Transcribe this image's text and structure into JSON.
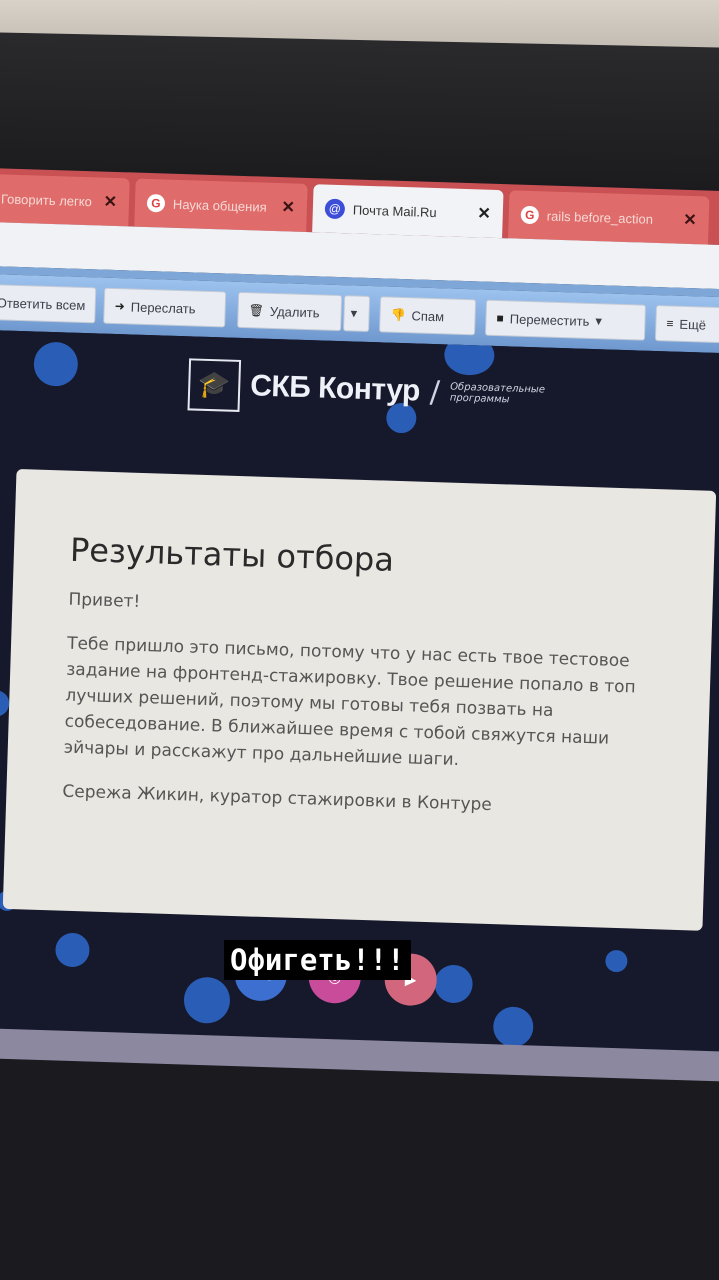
{
  "tabs": [
    {
      "title": "Говорить легко",
      "icon": "none",
      "close": "✕"
    },
    {
      "title": "Наука общения",
      "icon": "G",
      "close": "✕"
    },
    {
      "title": "Почта Mail.Ru",
      "icon": "@",
      "close": "✕"
    },
    {
      "title": "rails before_action",
      "icon": "G",
      "close": "✕"
    }
  ],
  "toolbar": {
    "reply_all": "Ответить всем",
    "forward": "Переслать",
    "delete": "Удалить",
    "spam": "Спам",
    "move": "Переместить",
    "more": "Ещё",
    "dropdown_arrow": "▾"
  },
  "brand": {
    "name": "СКБ Контур",
    "subtitle_line1": "Образовательные",
    "subtitle_line2": "программы"
  },
  "email": {
    "title": "Результаты отбора",
    "greeting": "Привет!",
    "body": "Тебе пришло это письмо, потому что у нас есть твое тестовое задание на фронтенд-стажировку. Твое решение попало в топ лучших решений, поэтому мы готовы тебя позвать на собеседование. В ближайшее время с тобой свяжутся наши эйчары и расскажут про дальнейшие шаги.",
    "signature": "Сережа Жикин, куратор стажировки в Контуре"
  },
  "social": {
    "vk": "vk",
    "instagram": "◎",
    "youtube": "▶"
  },
  "caption": "Офигеть!!!",
  "colors": {
    "tab_inactive": "#df6c6a",
    "tab_active": "#f2f3f7",
    "toolbar": "#8fb5e6",
    "page_bg": "#16182c",
    "accent_dots": "#2f6fd8"
  }
}
